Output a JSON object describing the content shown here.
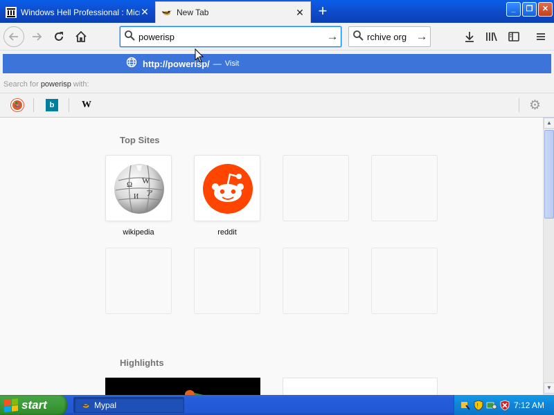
{
  "tabs": [
    {
      "label": "Windows Hell Professional : Micros",
      "active": false
    },
    {
      "label": "New Tab",
      "active": true
    }
  ],
  "window_buttons": {
    "minimize": "_",
    "restore": "❐",
    "close": "✕"
  },
  "urlbar": {
    "value": "powerisp"
  },
  "searchbar": {
    "value": "rchive org"
  },
  "autocomplete": {
    "suggestion_url": "http://powerisp/",
    "suggestion_sep": "—",
    "suggestion_action": "Visit",
    "search_for_prefix": "Search for",
    "search_for_term": "powerisp",
    "search_for_suffix": "with:",
    "engines": [
      {
        "name": "duckduckgo",
        "glyph": "🦆"
      },
      {
        "name": "bing",
        "glyph": "b"
      },
      {
        "name": "wikipedia",
        "glyph": "W"
      }
    ]
  },
  "newtab": {
    "top_sites_title": "Top Sites",
    "top_sites": [
      {
        "label": "wikipedia",
        "icon": "wikipedia-globe"
      },
      {
        "label": "reddit",
        "icon": "reddit-alien"
      }
    ],
    "highlights_title": "Highlights"
  },
  "taskbar": {
    "start_label": "start",
    "items": [
      {
        "label": "Mypal"
      }
    ],
    "clock": "7:12 AM"
  },
  "colors": {
    "accent": "#0a84ff",
    "suggest_highlight": "#3d74d9",
    "reddit": "#ff4500",
    "xp_blue": "#245edb",
    "xp_green": "#3c9b39"
  }
}
